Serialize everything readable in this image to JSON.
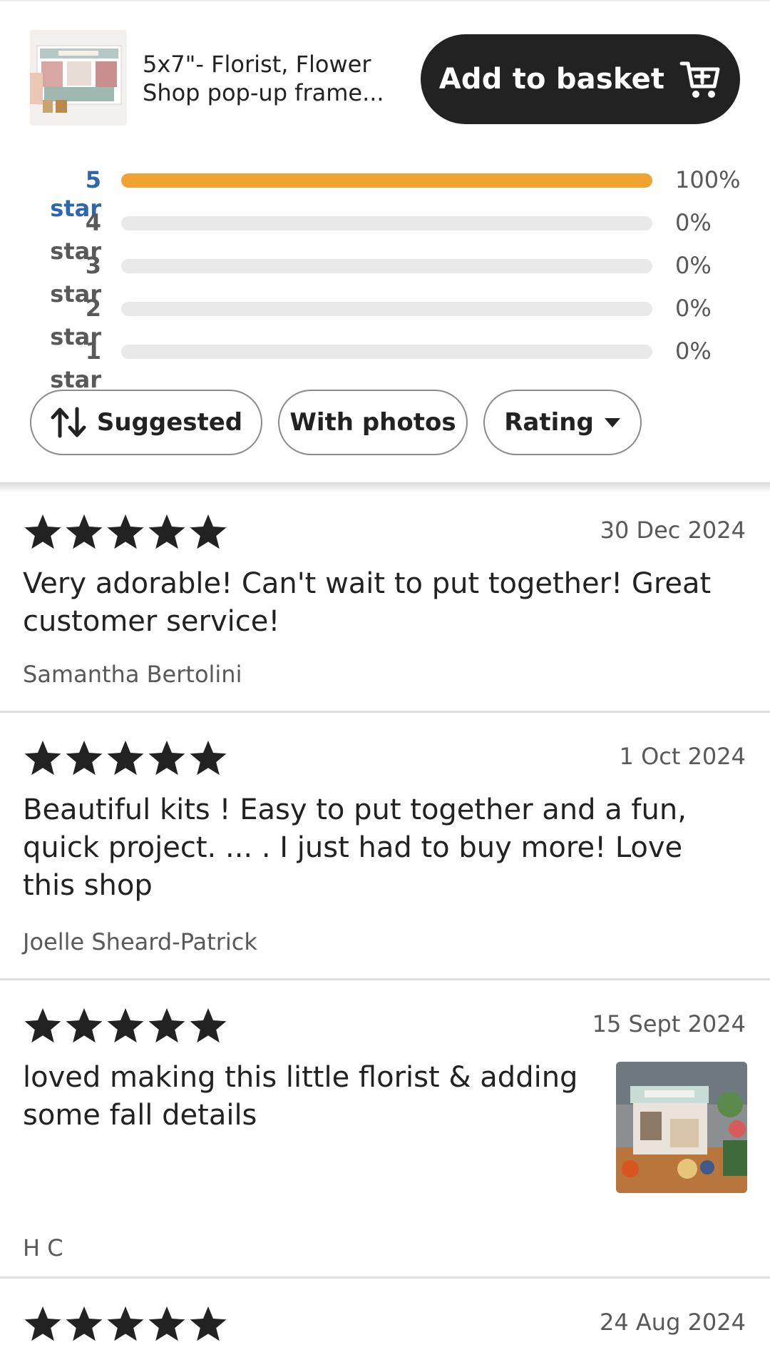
{
  "product": {
    "title": "5x7\"- Florist, Flower Shop pop-up frame...",
    "add_to_basket": "Add to basket",
    "cart_icon": "cart-plus-icon"
  },
  "breakdown": [
    {
      "label": "5 star",
      "percent": "100%",
      "fraction": 1.0
    },
    {
      "label": "4 star",
      "percent": "0%",
      "fraction": 0
    },
    {
      "label": "3 star",
      "percent": "0%",
      "fraction": 0
    },
    {
      "label": "2 star",
      "percent": "0%",
      "fraction": 0
    },
    {
      "label": "1 star",
      "percent": "0%",
      "fraction": 0
    }
  ],
  "filters": {
    "suggested": "Suggested",
    "with_photos": "With photos",
    "rating": "Rating"
  },
  "reviews": [
    {
      "stars": 5,
      "date": "30 Dec 2024",
      "text": "Very adorable! Can't wait to put together! Great customer service!",
      "author": "Samantha Bertolini"
    },
    {
      "stars": 5,
      "date": "1 Oct 2024",
      "text": "Beautiful kits ! Easy to put together and a fun, quick project. ... . I just had to buy more! Love this shop",
      "author": "Joelle Sheard-Patrick"
    },
    {
      "stars": 5,
      "date": "15 Sept 2024",
      "text": "loved making this little florist & adding some fall details",
      "author": "H C"
    },
    {
      "stars": 5,
      "date": "24 Aug 2024"
    }
  ],
  "colors": {
    "accent_bar": "#f1a332",
    "active_link": "#2f66b0",
    "button_dark": "#222222"
  }
}
